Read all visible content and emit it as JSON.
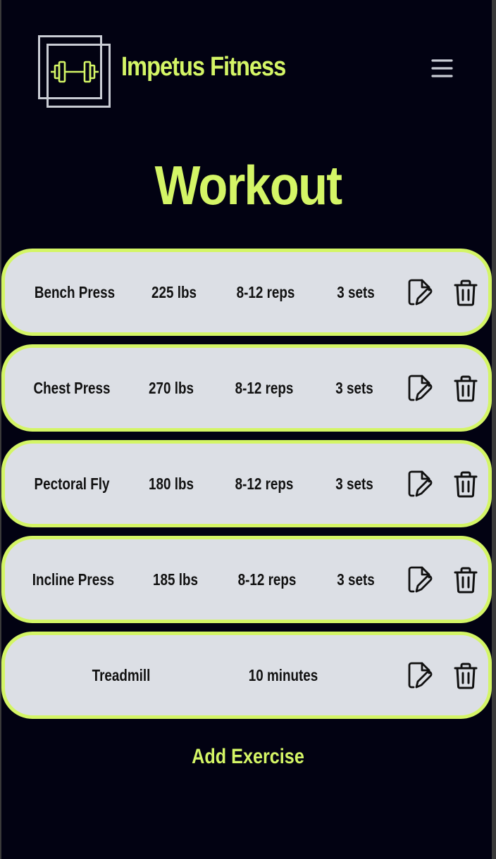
{
  "brand": {
    "name": "Impetus Fitness",
    "logo_icon": "dumbbell-icon",
    "accent_color": "#d4f566"
  },
  "header": {
    "menu_icon": "hamburger-menu-icon"
  },
  "page": {
    "title": "Workout"
  },
  "exercises": [
    {
      "name": "Bench Press",
      "weight": "225 lbs",
      "reps": "8-12 reps",
      "sets": "3 sets"
    },
    {
      "name": "Chest Press",
      "weight": "270 lbs",
      "reps": "8-12 reps",
      "sets": "3 sets"
    },
    {
      "name": "Pectoral Fly",
      "weight": "180 lbs",
      "reps": "8-12 reps",
      "sets": "3 sets"
    },
    {
      "name": "Incline Press",
      "weight": "185 lbs",
      "reps": "8-12 reps",
      "sets": "3 sets"
    }
  ],
  "cardio": {
    "name": "Treadmill",
    "duration": "10 minutes"
  },
  "row_actions": {
    "edit_icon": "edit-file-icon",
    "delete_icon": "trash-icon"
  },
  "actions": {
    "add_label": "Add Exercise"
  }
}
